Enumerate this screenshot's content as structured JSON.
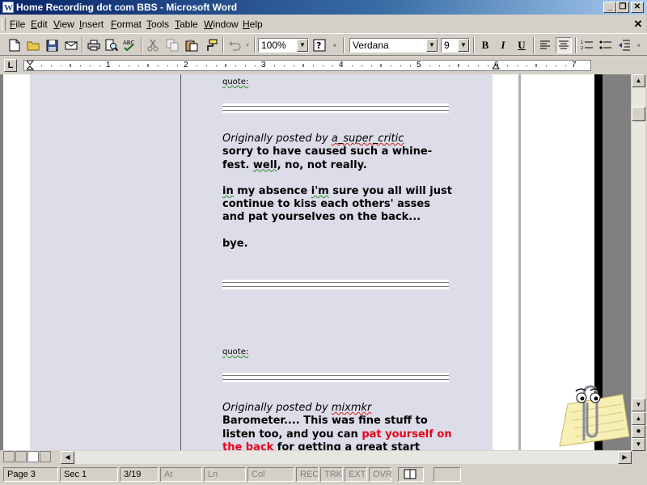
{
  "window": {
    "title": "Home Recording dot com BBS - Microsoft Word"
  },
  "menu": {
    "items": [
      "File",
      "Edit",
      "View",
      "Insert",
      "Format",
      "Tools",
      "Table",
      "Window",
      "Help"
    ]
  },
  "toolbar": {
    "zoom": "100%",
    "font": "Verdana",
    "font_size": "9",
    "bold_label": "B",
    "italic_label": "I",
    "underline_label": "U"
  },
  "ruler": {
    "labels": [
      "1",
      "2",
      "3",
      "4",
      "5",
      "6",
      "7"
    ]
  },
  "document": {
    "quote_label_1": "quote:",
    "post1": {
      "originally_posted_by": "Originally posted by",
      "author": "a_super_critic",
      "line1_part1": "sorry to have caused such a whine-fest. ",
      "line1_well": "well",
      "line1_part2": ", no, not really.",
      "p2_in": "in",
      "p2_part1": " my absence ",
      "p2_im": "i'm",
      "p2_part2": " sure you all will just continue to kiss each others' asses and pat yourselves on the back...",
      "p3": "bye."
    },
    "quote_label_2": "quote:",
    "post2": {
      "originally_posted_by": "Originally posted by",
      "author": "mixmkr",
      "text_part1": "Barometer.... This was fine stuff to listen too, and you can ",
      "highlight": "pat yourself on the back",
      "text_part2": " for getting a great start"
    }
  },
  "status": {
    "page": "Page 3",
    "section": "Sec 1",
    "page_count": "3/19",
    "at": "At",
    "ln": "Ln",
    "col": "Col",
    "rec": "REC",
    "trk": "TRK",
    "ext": "EXT",
    "ovr": "OVR"
  }
}
